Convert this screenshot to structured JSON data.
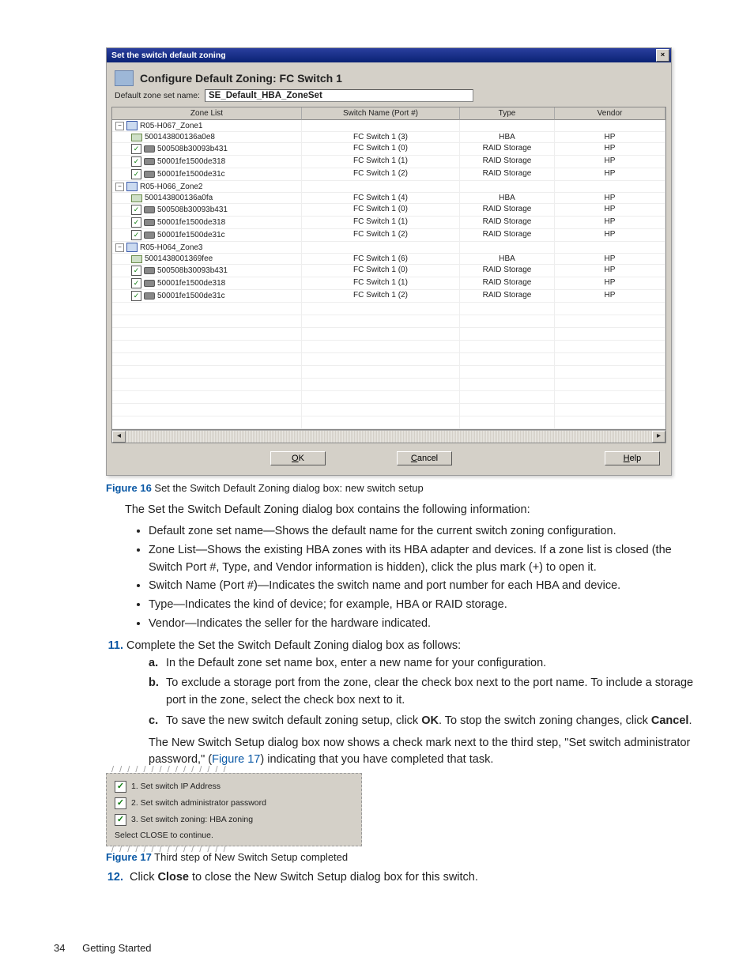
{
  "dialog": {
    "title": "Set the switch default zoning",
    "heading": "Configure Default Zoning: FC Switch 1",
    "zoneset_label": "Default zone set name:",
    "zoneset_value": "SE_Default_HBA_ZoneSet",
    "columns": {
      "c1": "Zone List",
      "c2": "Switch Name (Port #)",
      "c3": "Type",
      "c4": "Vendor"
    },
    "zones": [
      {
        "name": "R05-H067_Zone1",
        "rows": [
          {
            "checkbox": null,
            "icon": "card",
            "port": "500143800136a0e8",
            "switch": "FC Switch 1 (3)",
            "type": "HBA",
            "vendor": "HP"
          },
          {
            "checkbox": true,
            "icon": "disk",
            "port": "500508b30093b431",
            "switch": "FC Switch 1 (0)",
            "type": "RAID Storage",
            "vendor": "HP"
          },
          {
            "checkbox": true,
            "icon": "disk",
            "port": "50001fe1500de318",
            "switch": "FC Switch 1 (1)",
            "type": "RAID Storage",
            "vendor": "HP"
          },
          {
            "checkbox": true,
            "icon": "disk",
            "port": "50001fe1500de31c",
            "switch": "FC Switch 1 (2)",
            "type": "RAID Storage",
            "vendor": "HP"
          }
        ]
      },
      {
        "name": "R05-H066_Zone2",
        "rows": [
          {
            "checkbox": null,
            "icon": "card",
            "port": "500143800136a0fa",
            "switch": "FC Switch 1 (4)",
            "type": "HBA",
            "vendor": "HP"
          },
          {
            "checkbox": true,
            "icon": "disk",
            "port": "500508b30093b431",
            "switch": "FC Switch 1 (0)",
            "type": "RAID Storage",
            "vendor": "HP"
          },
          {
            "checkbox": true,
            "icon": "disk",
            "port": "50001fe1500de318",
            "switch": "FC Switch 1 (1)",
            "type": "RAID Storage",
            "vendor": "HP"
          },
          {
            "checkbox": true,
            "icon": "disk",
            "port": "50001fe1500de31c",
            "switch": "FC Switch 1 (2)",
            "type": "RAID Storage",
            "vendor": "HP"
          }
        ]
      },
      {
        "name": "R05-H064_Zone3",
        "rows": [
          {
            "checkbox": null,
            "icon": "card",
            "port": "5001438001369fee",
            "switch": "FC Switch 1 (6)",
            "type": "HBA",
            "vendor": "HP"
          },
          {
            "checkbox": true,
            "icon": "disk",
            "port": "500508b30093b431",
            "switch": "FC Switch 1 (0)",
            "type": "RAID Storage",
            "vendor": "HP"
          },
          {
            "checkbox": true,
            "icon": "disk",
            "port": "50001fe1500de318",
            "switch": "FC Switch 1 (1)",
            "type": "RAID Storage",
            "vendor": "HP"
          },
          {
            "checkbox": true,
            "icon": "disk",
            "port": "50001fe1500de31c",
            "switch": "FC Switch 1 (2)",
            "type": "RAID Storage",
            "vendor": "HP"
          }
        ]
      }
    ],
    "buttons": {
      "ok_u": "O",
      "ok_rest": "K",
      "cancel_u": "C",
      "cancel_rest": "ancel",
      "help_u": "H",
      "help_rest": "elp"
    }
  },
  "fig16": {
    "label": "Figure 16",
    "text": "  Set the Switch Default Zoning dialog box: new switch setup"
  },
  "intro": "The Set the Switch Default Zoning dialog box contains the following information:",
  "bullets": [
    "Default zone set name—Shows the default name for the current switch zoning configuration.",
    "Zone List—Shows the existing HBA zones with its HBA adapter and devices. If a zone list is closed (the Switch Port #, Type, and Vendor information is hidden), click the plus mark (+) to open it.",
    "Switch Name (Port #)—Indicates the switch name and port number for each HBA and device.",
    "Type—Indicates the kind of device; for example, HBA or RAID storage.",
    "Vendor—Indicates the seller for the hardware indicated."
  ],
  "step11": {
    "num": "11.",
    "text": "Complete the Set the Switch Default Zoning dialog box as follows:"
  },
  "alpha": {
    "a": "In the Default zone set name box, enter a new name for your configuration.",
    "b": "To exclude a storage port from the zone, clear the check box next to the port name. To include a storage port in the zone, select the check box next to it.",
    "c_pre": "To save the new switch default zoning setup, click ",
    "c_ok": "OK",
    "c_mid": ". To stop the switch zoning changes, click ",
    "c_cancel": "Cancel",
    "c_post": "."
  },
  "after_alpha_pre": "The New Switch Setup dialog box now shows a check mark next to the third step, \"Set switch administrator password,\" (",
  "after_alpha_link": "Figure 17",
  "after_alpha_post": ") indicating that you have completed that task.",
  "shot2": {
    "steps": [
      {
        "checked": true,
        "label": "1. Set switch IP Address"
      },
      {
        "checked": true,
        "label": "2. Set switch administrator password"
      },
      {
        "checked": true,
        "label": "3. Set switch zoning: HBA zoning"
      }
    ],
    "hint": "Select CLOSE to continue."
  },
  "fig17": {
    "label": "Figure 17",
    "text": "  Third step of New Switch Setup completed"
  },
  "step12": {
    "num": "12.",
    "pre": "Click ",
    "bold": "Close",
    "post": " to close the New Switch Setup dialog box for this switch."
  },
  "footer": {
    "page": "34",
    "section": "Getting Started"
  }
}
